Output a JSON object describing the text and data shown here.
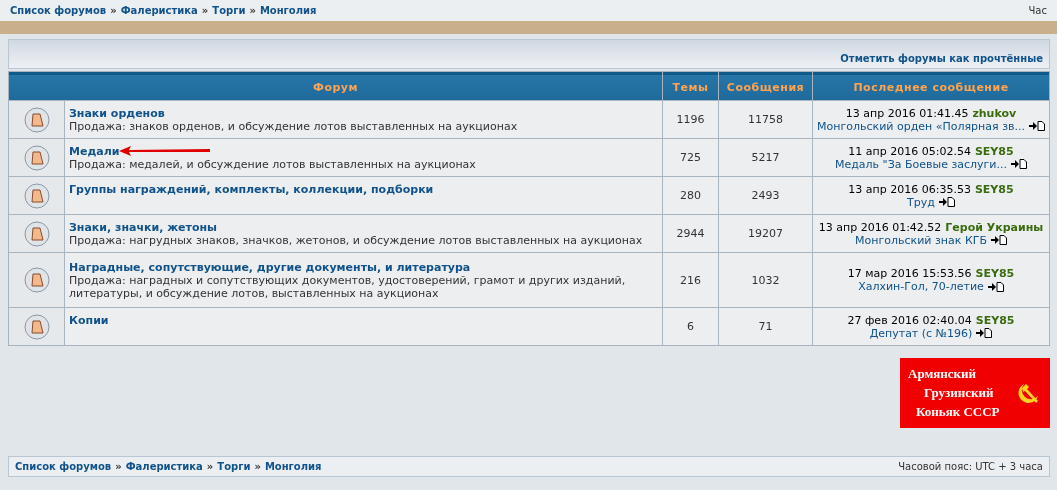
{
  "breadcrumb_top": {
    "separator": "»",
    "items": [
      "Список форумов",
      "Фалеристика",
      "Торги",
      "Монголия"
    ],
    "right_text": "Час"
  },
  "mark_read_link": "Отметить форумы как прочтённые",
  "table": {
    "columns": [
      "Форум",
      "Темы",
      "Сообщения",
      "Последнее сообщение"
    ],
    "rows": [
      {
        "title": "Знаки орденов",
        "description": "Продажа: знаков орденов, и обсуждение лотов выставленных на аукционах",
        "topics": "1196",
        "posts": "11758",
        "last_date": "13 апр 2016 01:41.45",
        "last_author": "zhukov",
        "last_topic": "Монгольский орден «Полярная зв...",
        "annotated": false
      },
      {
        "title": "Медали",
        "description": "Продажа: медалей, и обсуждение лотов выставленных на аукционах",
        "topics": "725",
        "posts": "5217",
        "last_date": "11 апр 2016 05:02.54",
        "last_author": "SEY85",
        "last_topic": "Медаль \"За Боевые заслуги...",
        "annotated": true
      },
      {
        "title": "Группы награждений, комплекты, коллекции, подборки",
        "topics": "280",
        "posts": "2493",
        "last_date": "13 апр 2016 06:35.53",
        "last_author": "SEY85",
        "last_topic": "Труд",
        "annotated": false
      },
      {
        "title": "Знаки, значки, жетоны",
        "description": "Продажа: нагрудных знаков, значков, жетонов, и обсуждение лотов выставленных на аукционах",
        "topics": "2944",
        "posts": "19207",
        "last_date": "13 апр 2016 01:42.52",
        "last_author": "Герой Украины",
        "last_topic": "Монгольский знак КГБ",
        "annotated": false
      },
      {
        "title": "Наградные, сопутствующие, другие документы, и литература",
        "description": "Продажа: наградных и сопутствующих документов, удостоверений, грамот и других изданий, литературы, и обсуждение лотов, выставленных на аукционах",
        "topics": "216",
        "posts": "1032",
        "last_date": "17 мар 2016 15:53.56",
        "last_author": "SEY85",
        "last_topic": "Халхин-Гол, 70-летие",
        "annotated": false
      },
      {
        "title": "Копии",
        "topics": "6",
        "posts": "71",
        "last_date": "27 фев 2016 02:40.04",
        "last_author": "SEY85",
        "last_topic": "Депутат (с №196)",
        "annotated": false
      }
    ]
  },
  "banner": {
    "lines": [
      "Армянский",
      "Грузинский",
      "Коньяк СССР"
    ]
  },
  "breadcrumb_bottom": {
    "separator": "»",
    "items": [
      "Список форумов",
      "Фалеристика",
      "Торги",
      "Монголия"
    ],
    "timezone": "Часовой пояс: UTC + 3 часа"
  }
}
